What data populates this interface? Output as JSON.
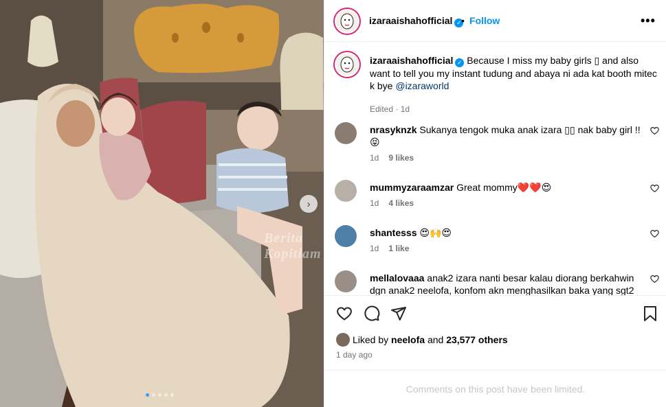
{
  "post": {
    "header": {
      "username": "izaraaishahofficial",
      "separator": "•",
      "follow_label": "Follow",
      "more_icon": "more-horizontal-icon"
    },
    "caption": {
      "username": "izaraaishahofficial",
      "text_before_mention": "Because I miss my baby girls ▯ and also want to tell you my instant tudung and abaya ni ada kat booth mitec k bye",
      "mention": "@izaraworld",
      "meta": "Edited · 1d"
    },
    "comments": [
      {
        "username": "nrasyknzk",
        "text": "Sukanya tengok muka anak izara ▯▯ nak baby girl !! 😝",
        "age": "1d",
        "likes": "9 likes"
      },
      {
        "username": "mummyzaraamzar",
        "text": "Great mommy❤️❤️😍",
        "age": "1d",
        "likes": "4 likes"
      },
      {
        "username": "shantesss",
        "text": "😍🙌😍",
        "age": "1d",
        "likes": "1 like"
      },
      {
        "username": "mellalovaaa",
        "text": "anak2 izara nanti besar kalau diorang berkahwin dgn anak2 neelofa, konfom akn menghasilkan baka yang sgt2",
        "age": "",
        "likes": ""
      }
    ],
    "liked_by": {
      "prefix": "Liked by",
      "user": "neelofa",
      "middle": "and",
      "count": "23,577 others"
    },
    "timestamp": "1 day ago",
    "comments_limited": "Comments on this post have been limited.",
    "carousel": {
      "current": 1,
      "total": 5
    },
    "watermark": "Berita Kopitiam",
    "colors": {
      "accent": "#0095f6",
      "muted": "#737373",
      "ring": "#d62976"
    }
  }
}
